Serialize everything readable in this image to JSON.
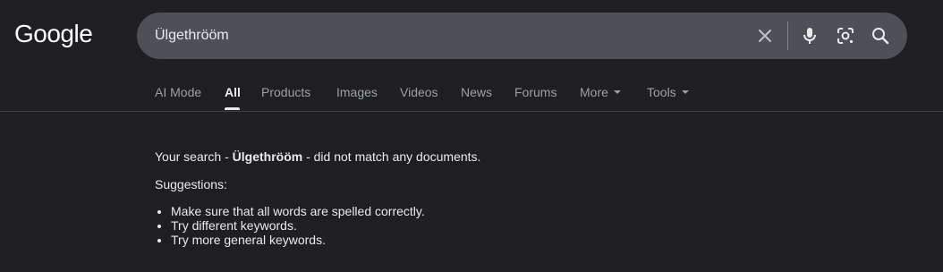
{
  "logo": {
    "text": "Google"
  },
  "search": {
    "value": "Ülgethrööm",
    "placeholder": "",
    "icons": [
      "close-icon",
      "mic-icon",
      "lens-icon",
      "search-icon"
    ]
  },
  "tabs": [
    {
      "label": "AI Mode",
      "active": false
    },
    {
      "label": "All",
      "active": true
    },
    {
      "label": "Products",
      "active": false
    },
    {
      "label": "Images",
      "active": false
    },
    {
      "label": "Videos",
      "active": false
    },
    {
      "label": "News",
      "active": false
    },
    {
      "label": "Forums",
      "active": false
    },
    {
      "label": "More",
      "active": false
    },
    {
      "label": "Tools",
      "active": false
    }
  ],
  "results": {
    "prefix": "Your search - ",
    "query": "Ülgethrööm",
    "suffix": " - did not match any documents.",
    "suggestions_title": "Suggestions:",
    "suggestions": [
      "Make sure that all words are spelled correctly.",
      "Try different keywords.",
      "Try more general keywords."
    ]
  },
  "colors": {
    "background": "#1f1f23",
    "searchbar": "#4d5055",
    "text": "#e8eaed",
    "muted": "#9aa0a6"
  }
}
